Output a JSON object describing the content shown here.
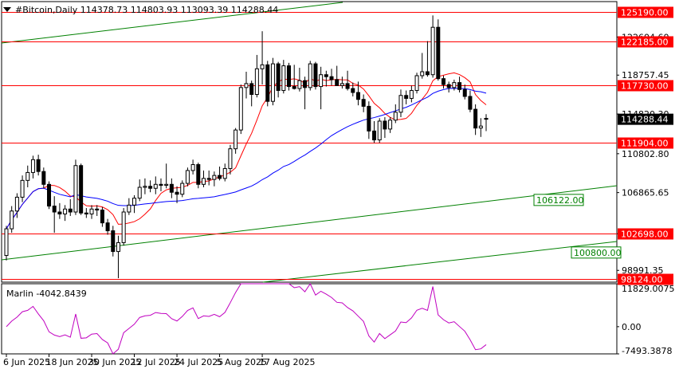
{
  "header": {
    "symbol_line": "#Bitcoin,Daily  114378.73 114803.93 113093.39 114288.44"
  },
  "colors": {
    "background": "#ffffff",
    "bull_body": "#ffffff",
    "bear_body": "#000000",
    "candle_outline": "#000000",
    "level_line": "#ff0000",
    "level_label_bg": "#ff0000",
    "channel_line": "#008000",
    "ma_fast": "#ff0000",
    "ma_slow": "#0000ff",
    "oscillator": "#c000c0",
    "current_price_bg": "#000000"
  },
  "chart_data": {
    "type": "candlestick",
    "price_axis": {
      "range": [
        97800,
        126200
      ],
      "ticks": [
        "122604.60",
        "118757.45",
        "114820.30",
        "110802.80",
        "106865.65",
        "102698.00",
        "98991.35"
      ]
    },
    "time_axis": {
      "labels": [
        "6 Jun 2025",
        "18 Jun 2025",
        "30 Jun 2025",
        "12 Jul 2025",
        "24 Jul 2025",
        "5 Aug 2025",
        "17 Aug 2025"
      ]
    },
    "levels": [
      {
        "label": "125190.00",
        "value": 125190
      },
      {
        "label": "122185.00",
        "value": 122185
      },
      {
        "label": "117730.00",
        "value": 117730
      },
      {
        "label": "111904.00",
        "value": 111904
      },
      {
        "label": "102698.00",
        "value": 102698
      },
      {
        "label": "98124.00",
        "value": 98124
      }
    ],
    "current_price": {
      "label": "114288.44",
      "value": 114288.44
    },
    "channel_labels": [
      {
        "label": "106122.00",
        "value": 106122
      },
      {
        "label": "100800.00",
        "value": 100800
      }
    ],
    "candles": [
      {
        "o": 100500,
        "h": 103500,
        "l": 100000,
        "c": 103200
      },
      {
        "o": 103200,
        "h": 105500,
        "l": 102800,
        "c": 105000
      },
      {
        "o": 105000,
        "h": 106800,
        "l": 104300,
        "c": 106400
      },
      {
        "o": 106400,
        "h": 108600,
        "l": 105900,
        "c": 108100
      },
      {
        "o": 108100,
        "h": 109600,
        "l": 107400,
        "c": 108900
      },
      {
        "o": 108900,
        "h": 110600,
        "l": 108300,
        "c": 110200
      },
      {
        "o": 110200,
        "h": 110700,
        "l": 108600,
        "c": 109000
      },
      {
        "o": 109000,
        "h": 109400,
        "l": 107300,
        "c": 107700
      },
      {
        "o": 107700,
        "h": 108000,
        "l": 105200,
        "c": 105500
      },
      {
        "o": 105500,
        "h": 106500,
        "l": 102800,
        "c": 104900
      },
      {
        "o": 104900,
        "h": 105800,
        "l": 104200,
        "c": 104700
      },
      {
        "o": 104700,
        "h": 105600,
        "l": 104000,
        "c": 105200
      },
      {
        "o": 105200,
        "h": 106200,
        "l": 104500,
        "c": 104900
      },
      {
        "o": 104900,
        "h": 110200,
        "l": 104600,
        "c": 109600
      },
      {
        "o": 109600,
        "h": 109800,
        "l": 104600,
        "c": 104800
      },
      {
        "o": 104800,
        "h": 105300,
        "l": 104300,
        "c": 104700
      },
      {
        "o": 104700,
        "h": 105600,
        "l": 104200,
        "c": 105200
      },
      {
        "o": 105200,
        "h": 105600,
        "l": 104500,
        "c": 105100
      },
      {
        "o": 105100,
        "h": 105400,
        "l": 103400,
        "c": 103800
      },
      {
        "o": 103800,
        "h": 104200,
        "l": 102600,
        "c": 103000
      },
      {
        "o": 103000,
        "h": 103500,
        "l": 100400,
        "c": 100900
      },
      {
        "o": 100900,
        "h": 102500,
        "l": 98200,
        "c": 101800
      },
      {
        "o": 101800,
        "h": 105300,
        "l": 101500,
        "c": 104900
      },
      {
        "o": 104900,
        "h": 106300,
        "l": 104600,
        "c": 105600
      },
      {
        "o": 105600,
        "h": 106600,
        "l": 104800,
        "c": 106300
      },
      {
        "o": 106300,
        "h": 108200,
        "l": 106000,
        "c": 107400
      },
      {
        "o": 107400,
        "h": 108300,
        "l": 106700,
        "c": 107500
      },
      {
        "o": 107500,
        "h": 108100,
        "l": 106900,
        "c": 107300
      },
      {
        "o": 107300,
        "h": 108500,
        "l": 106700,
        "c": 107700
      },
      {
        "o": 107700,
        "h": 108300,
        "l": 107000,
        "c": 107600
      },
      {
        "o": 107600,
        "h": 109800,
        "l": 107300,
        "c": 107700
      },
      {
        "o": 107700,
        "h": 108300,
        "l": 106300,
        "c": 106900
      },
      {
        "o": 106900,
        "h": 107500,
        "l": 105800,
        "c": 106700
      },
      {
        "o": 106700,
        "h": 108100,
        "l": 106400,
        "c": 107800
      },
      {
        "o": 107800,
        "h": 109400,
        "l": 107500,
        "c": 109100
      },
      {
        "o": 109100,
        "h": 110200,
        "l": 108700,
        "c": 109700
      },
      {
        "o": 109700,
        "h": 109900,
        "l": 107300,
        "c": 107700
      },
      {
        "o": 107700,
        "h": 109100,
        "l": 107400,
        "c": 108300
      },
      {
        "o": 108300,
        "h": 109100,
        "l": 107600,
        "c": 108200
      },
      {
        "o": 108200,
        "h": 109000,
        "l": 107500,
        "c": 108600
      },
      {
        "o": 108600,
        "h": 109500,
        "l": 108100,
        "c": 108300
      },
      {
        "o": 108300,
        "h": 109800,
        "l": 108000,
        "c": 109300
      },
      {
        "o": 109300,
        "h": 111700,
        "l": 108700,
        "c": 111300
      },
      {
        "o": 111300,
        "h": 113400,
        "l": 110800,
        "c": 113200
      },
      {
        "o": 113200,
        "h": 117800,
        "l": 112800,
        "c": 117500
      },
      {
        "o": 117500,
        "h": 119100,
        "l": 116400,
        "c": 117900
      },
      {
        "o": 117900,
        "h": 118200,
        "l": 115600,
        "c": 116800
      },
      {
        "o": 116800,
        "h": 120800,
        "l": 116500,
        "c": 119400
      },
      {
        "o": 119400,
        "h": 123200,
        "l": 117800,
        "c": 119800
      },
      {
        "o": 119800,
        "h": 120200,
        "l": 115600,
        "c": 116100
      },
      {
        "o": 116100,
        "h": 120500,
        "l": 115700,
        "c": 119900
      },
      {
        "o": 119900,
        "h": 120100,
        "l": 116500,
        "c": 117200
      },
      {
        "o": 117200,
        "h": 120300,
        "l": 116900,
        "c": 119700
      },
      {
        "o": 119700,
        "h": 120000,
        "l": 117200,
        "c": 117600
      },
      {
        "o": 117600,
        "h": 119800,
        "l": 117300,
        "c": 117400
      },
      {
        "o": 117400,
        "h": 119500,
        "l": 117100,
        "c": 118200
      },
      {
        "o": 118200,
        "h": 118600,
        "l": 115300,
        "c": 117500
      },
      {
        "o": 117500,
        "h": 120200,
        "l": 117200,
        "c": 119900
      },
      {
        "o": 119900,
        "h": 120100,
        "l": 117300,
        "c": 117600
      },
      {
        "o": 117600,
        "h": 119600,
        "l": 115300,
        "c": 118800
      },
      {
        "o": 118800,
        "h": 119200,
        "l": 117600,
        "c": 118600
      },
      {
        "o": 118600,
        "h": 119400,
        "l": 117700,
        "c": 118300
      },
      {
        "o": 118300,
        "h": 119700,
        "l": 117800,
        "c": 117700
      },
      {
        "o": 117700,
        "h": 118600,
        "l": 117400,
        "c": 117900
      },
      {
        "o": 117900,
        "h": 119200,
        "l": 117200,
        "c": 117400
      },
      {
        "o": 117400,
        "h": 118000,
        "l": 116600,
        "c": 117000
      },
      {
        "o": 117000,
        "h": 118100,
        "l": 115700,
        "c": 116300
      },
      {
        "o": 116300,
        "h": 116800,
        "l": 115000,
        "c": 115600
      },
      {
        "o": 115600,
        "h": 116100,
        "l": 112300,
        "c": 113100
      },
      {
        "o": 113100,
        "h": 114100,
        "l": 111900,
        "c": 112200
      },
      {
        "o": 112200,
        "h": 114400,
        "l": 111900,
        "c": 114100
      },
      {
        "o": 114100,
        "h": 114500,
        "l": 112400,
        "c": 113300
      },
      {
        "o": 113300,
        "h": 114500,
        "l": 112900,
        "c": 114200
      },
      {
        "o": 114200,
        "h": 115800,
        "l": 113900,
        "c": 115000
      },
      {
        "o": 115000,
        "h": 117300,
        "l": 114500,
        "c": 116700
      },
      {
        "o": 116700,
        "h": 117200,
        "l": 115800,
        "c": 116400
      },
      {
        "o": 116400,
        "h": 117700,
        "l": 116000,
        "c": 117200
      },
      {
        "o": 117200,
        "h": 119000,
        "l": 116900,
        "c": 118700
      },
      {
        "o": 118700,
        "h": 121000,
        "l": 118400,
        "c": 119100
      },
      {
        "o": 119100,
        "h": 122200,
        "l": 118600,
        "c": 118800
      },
      {
        "o": 118800,
        "h": 124800,
        "l": 118500,
        "c": 123600
      },
      {
        "o": 123600,
        "h": 124400,
        "l": 118200,
        "c": 118400
      },
      {
        "o": 118400,
        "h": 118700,
        "l": 117400,
        "c": 117800
      },
      {
        "o": 117800,
        "h": 118100,
        "l": 117000,
        "c": 117500
      },
      {
        "o": 117500,
        "h": 118300,
        "l": 117200,
        "c": 118000
      },
      {
        "o": 118000,
        "h": 118600,
        "l": 117000,
        "c": 117300
      },
      {
        "o": 117300,
        "h": 117800,
        "l": 116300,
        "c": 116600
      },
      {
        "o": 116600,
        "h": 117200,
        "l": 115000,
        "c": 115300
      },
      {
        "o": 115300,
        "h": 115800,
        "l": 112700,
        "c": 113400
      },
      {
        "o": 113400,
        "h": 114400,
        "l": 112500,
        "c": 113600
      },
      {
        "o": 114378.73,
        "h": 114803.93,
        "l": 113093.39,
        "c": 114288.44
      }
    ],
    "oscillator": {
      "label": "Marlin -4042.8439",
      "range": [
        -7493.3878,
        11829.0075
      ],
      "ticks": [
        "11829.0075",
        "0.00",
        "-7493.3878"
      ]
    }
  }
}
